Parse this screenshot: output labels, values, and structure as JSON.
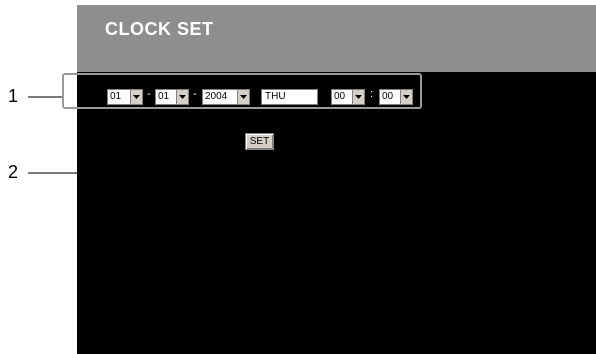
{
  "header": {
    "title": "CLOCK SET"
  },
  "callouts": {
    "one": "1",
    "two": "2"
  },
  "date": {
    "month": "01",
    "day": "01",
    "year": "2004",
    "separator": "-"
  },
  "weekday": "THU",
  "time": {
    "hour": "00",
    "minute": "00",
    "separator": ":"
  },
  "actions": {
    "set_label": "SET"
  },
  "icons": {
    "dropdown": "chevron-down-icon"
  },
  "colors": {
    "header_bg": "#8e8e8e",
    "screen_bg": "#000000",
    "button_bg": "#d4d0c8"
  }
}
